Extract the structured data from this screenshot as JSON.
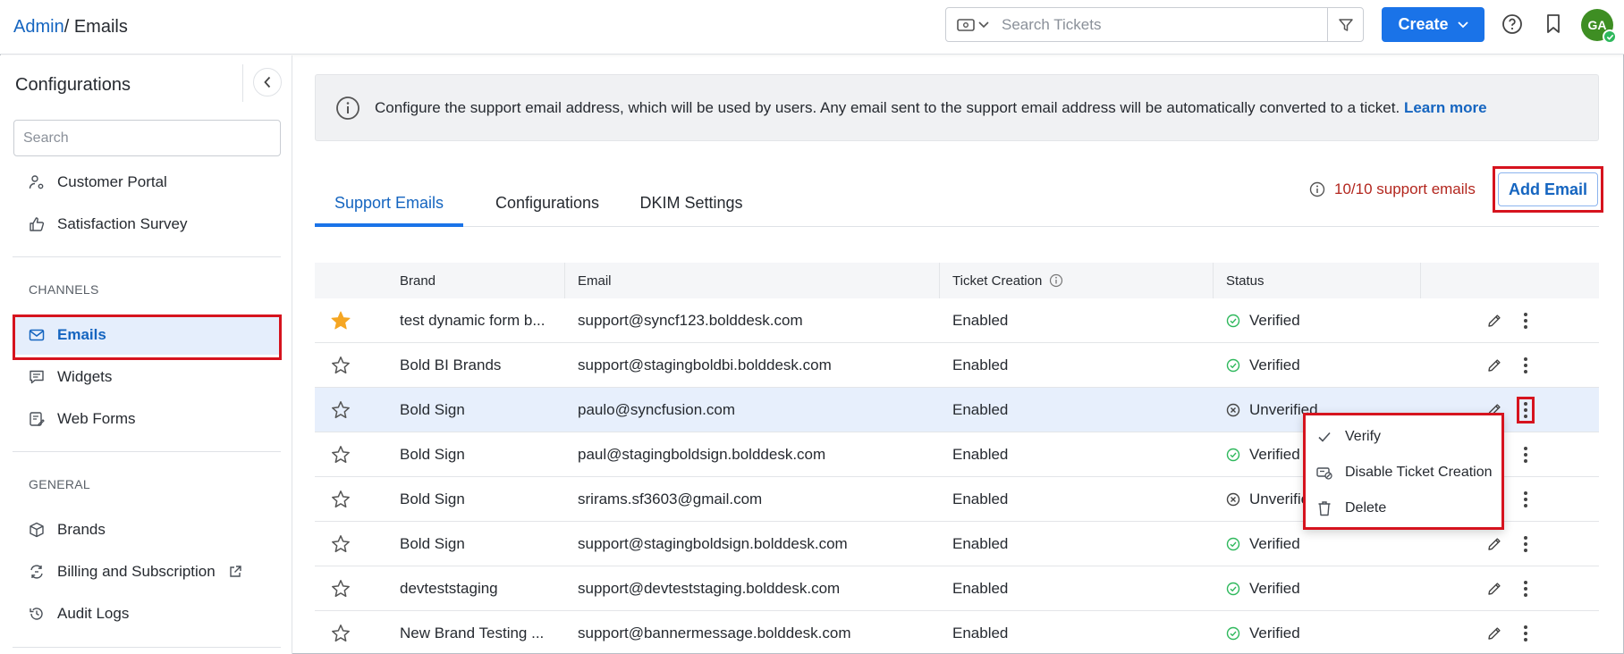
{
  "header": {
    "breadcrumb_root": "Admin",
    "breadcrumb_sep": "/ ",
    "breadcrumb_current": "Emails",
    "search_placeholder": "Search Tickets",
    "create_label": "Create",
    "avatar_initials": "GA",
    "icons": [
      "ticket-scope-icon",
      "filter-icon",
      "help-icon",
      "bookmark-icon"
    ]
  },
  "sidebar": {
    "title": "Configurations",
    "search_placeholder": "Search",
    "items_top": [
      {
        "label": "Customer Portal",
        "icon": "user-gear-icon"
      },
      {
        "label": "Satisfaction Survey",
        "icon": "thumbs-up-icon"
      }
    ],
    "channels_label": "CHANNELS",
    "channels": [
      {
        "label": "Emails",
        "icon": "mail-icon",
        "active": true
      },
      {
        "label": "Widgets",
        "icon": "chat-icon"
      },
      {
        "label": "Web Forms",
        "icon": "form-icon"
      }
    ],
    "general_label": "GENERAL",
    "general": [
      {
        "label": "Brands",
        "icon": "cube-icon"
      },
      {
        "label": "Billing and Subscription",
        "icon": "billing-icon",
        "external": true
      },
      {
        "label": "Audit Logs",
        "icon": "history-icon"
      }
    ]
  },
  "banner": {
    "text": "Configure the support email address, which will be used by users. Any email sent to the support email address will be automatically converted to a ticket.",
    "link": "Learn more"
  },
  "tabs": [
    {
      "label": "Support Emails",
      "active": true
    },
    {
      "label": "Configurations"
    },
    {
      "label": "DKIM Settings"
    }
  ],
  "quota_text": "10/10 support emails",
  "add_email_label": "Add Email",
  "table": {
    "headers": {
      "brand": "Brand",
      "email": "Email",
      "ticket_creation": "Ticket Creation",
      "status": "Status"
    },
    "rows": [
      {
        "starred": true,
        "brand": "test dynamic form b...",
        "email": "support@syncf123.bolddesk.com",
        "ticket_creation": "Enabled",
        "status": "Verified"
      },
      {
        "starred": false,
        "brand": "Bold BI Brands",
        "email": "support@stagingboldbi.bolddesk.com",
        "ticket_creation": "Enabled",
        "status": "Verified"
      },
      {
        "starred": false,
        "brand": "Bold Sign",
        "email": "paulo@syncfusion.com",
        "ticket_creation": "Enabled",
        "status": "Unverified"
      },
      {
        "starred": false,
        "brand": "Bold Sign",
        "email": "paul@stagingboldsign.bolddesk.com",
        "ticket_creation": "Enabled",
        "status": "Verified"
      },
      {
        "starred": false,
        "brand": "Bold Sign",
        "email": "srirams.sf3603@gmail.com",
        "ticket_creation": "Enabled",
        "status": "Unverified"
      },
      {
        "starred": false,
        "brand": "Bold Sign",
        "email": "support@stagingboldsign.bolddesk.com",
        "ticket_creation": "Enabled",
        "status": "Verified"
      },
      {
        "starred": false,
        "brand": "devteststaging",
        "email": "support@devteststaging.bolddesk.com",
        "ticket_creation": "Enabled",
        "status": "Verified"
      },
      {
        "starred": false,
        "brand": "New Brand Testing ...",
        "email": "support@bannermessage.bolddesk.com",
        "ticket_creation": "Enabled",
        "status": "Verified"
      }
    ]
  },
  "context_menu": [
    {
      "label": "Verify",
      "icon": "check-icon"
    },
    {
      "label": "Disable Ticket Creation",
      "icon": "disable-ticket-icon"
    },
    {
      "label": "Delete",
      "icon": "trash-icon"
    }
  ],
  "colors": {
    "accent": "#1a73e8",
    "highlight": "#d6131e",
    "verified": "#2eb85c",
    "quota": "#b3261e"
  }
}
